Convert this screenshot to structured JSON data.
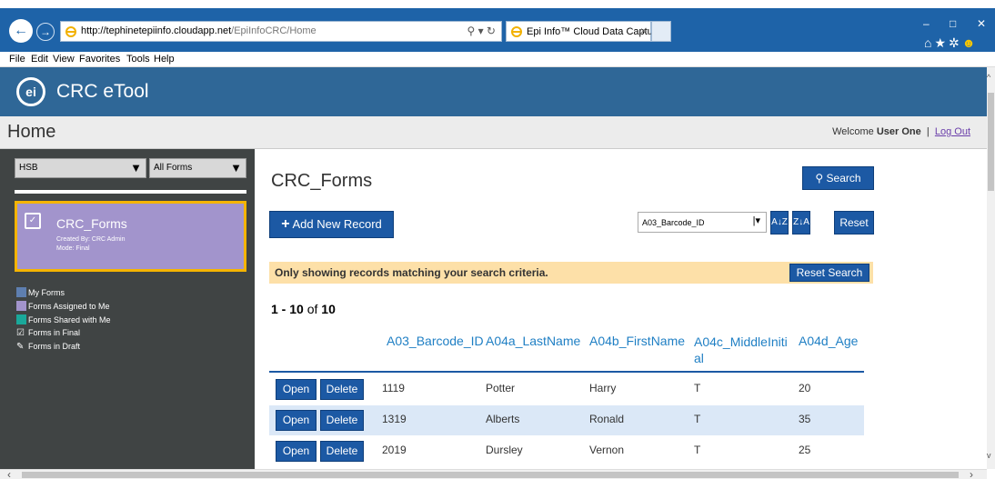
{
  "browser": {
    "url_domain": "http://tephinetepiinfo.cloudapp.net",
    "url_path": "/EpiInfoCRC/Home",
    "tab_title": "Epi Info™ Cloud Data Captu...",
    "tab_close": "×",
    "window_controls": [
      "–",
      "□",
      "✕"
    ],
    "menu": [
      "File",
      "Edit",
      "View",
      "Favorites",
      "Tools",
      "Help"
    ]
  },
  "app": {
    "logo_text": "ei",
    "title": "CRC eTool",
    "page": "Home",
    "welcome_prefix": "Welcome ",
    "user": "User One",
    "separator": "|",
    "logout": "Log Out"
  },
  "sidebar": {
    "org_select": "HSB",
    "forms_select": "All Forms",
    "card": {
      "name": "CRC_Forms",
      "created_by": "Created By: CRC Admin",
      "mode": "Mode: Final"
    },
    "legend": [
      {
        "label": "My Forms",
        "color": "#5e7fb0"
      },
      {
        "label": "Forms Assigned to Me",
        "color": "#a294cc"
      },
      {
        "label": "Forms Shared with Me",
        "color": "#1aa89a"
      },
      {
        "label": "Forms in Final",
        "icon": "final-icon"
      },
      {
        "label": "Forms in Draft",
        "icon": "draft-icon"
      }
    ]
  },
  "main": {
    "form_title": "CRC_Forms",
    "search_label": "Search",
    "add_label": "Add New Record",
    "sort_field": "A03_Barcode_ID",
    "sort_asc": "A↓Z",
    "sort_desc": "Z↓A",
    "reset_label": "Reset",
    "notice": "Only showing records matching your search criteria.",
    "reset_search_label": "Reset Search",
    "count_range": "1 - 10",
    "count_of": " of ",
    "count_total": "10",
    "columns": [
      "A03_Barcode_ID",
      "A04a_LastName",
      "A04b_FirstName",
      "A04c_MiddleIniti al",
      "A04d_Age"
    ],
    "open_label": "Open",
    "delete_label": "Delete",
    "rows": [
      {
        "id": "1119",
        "last": "Potter",
        "first": "Harry",
        "middle": "T",
        "age": "20"
      },
      {
        "id": "1319",
        "last": "Alberts",
        "first": "Ronald",
        "middle": "T",
        "age": "35"
      },
      {
        "id": "2019",
        "last": "Dursley",
        "first": "Vernon",
        "middle": "T",
        "age": "25"
      }
    ]
  }
}
